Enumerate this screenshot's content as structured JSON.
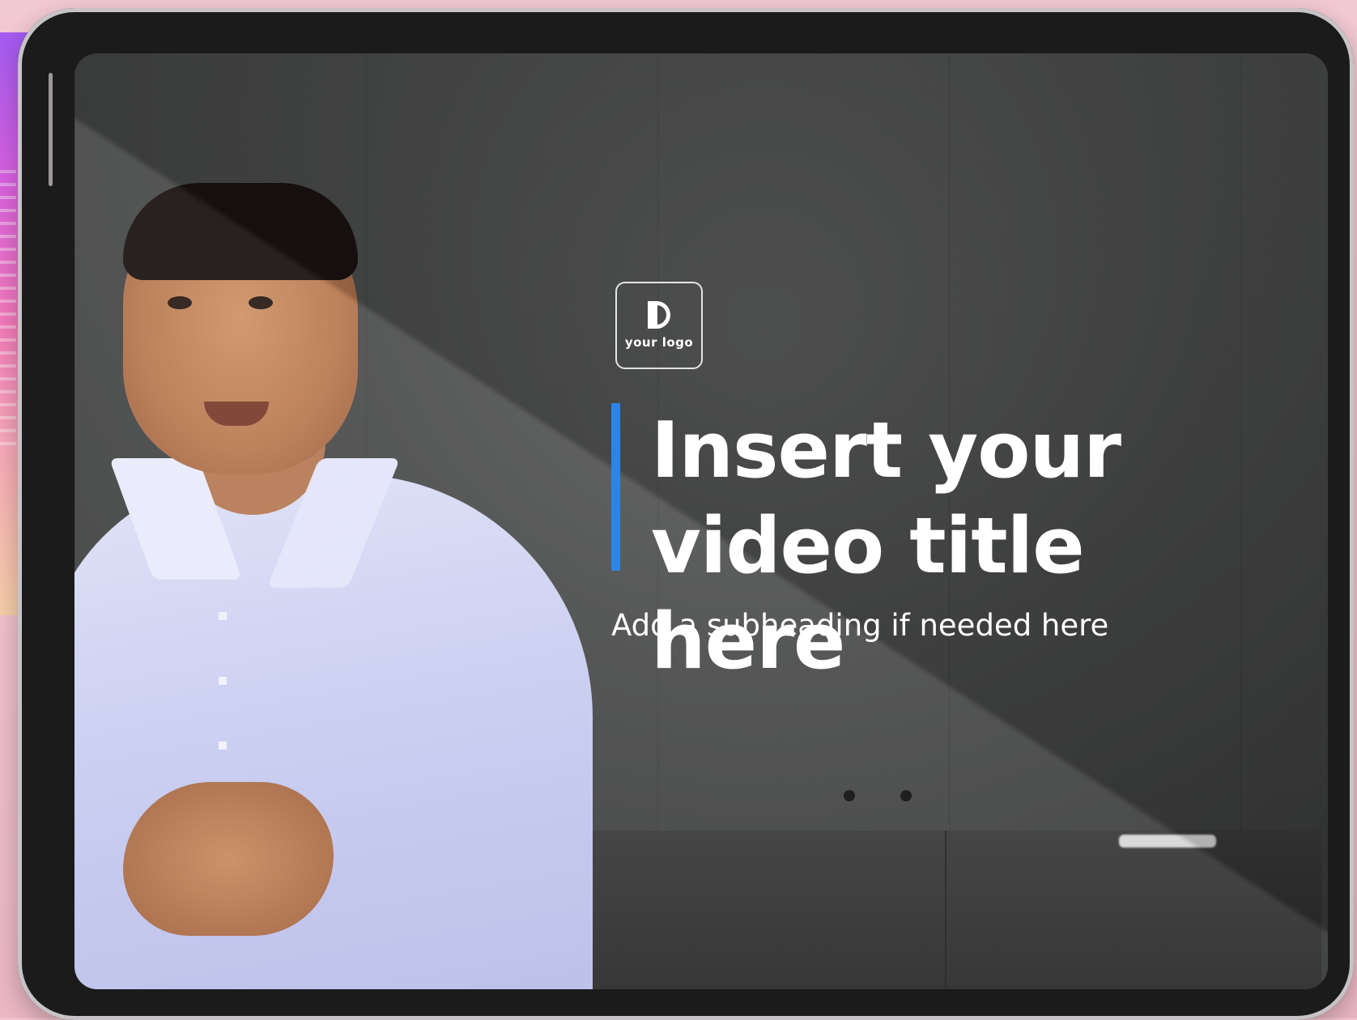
{
  "slide": {
    "logo_text": "your logo",
    "title_line1": "Insert your",
    "title_line2": "video title here",
    "subtitle": "Add a subheading if needed here"
  },
  "colors": {
    "accent_bar": "#2d84e8",
    "background": "#f2c4cf",
    "tablet_frame": "#1b1b1c"
  },
  "icons": {
    "logo": "logo-icon"
  }
}
